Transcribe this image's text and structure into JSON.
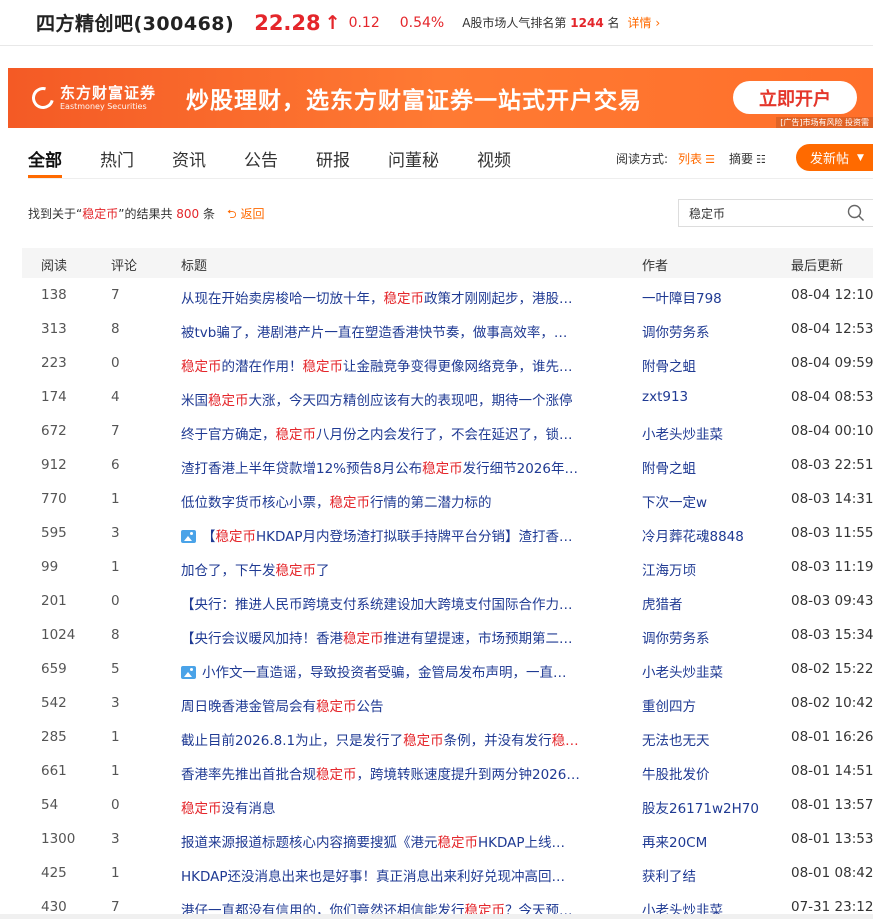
{
  "stock": {
    "name": "四方精创吧(300468)",
    "price": "22.28",
    "change": "0.12",
    "change_pct": "0.54%",
    "rank_prefix": "A股市场人气排名第",
    "rank": "1244",
    "rank_suffix": "名",
    "detail_label": "详情",
    "color_up": "#e4262b"
  },
  "banner": {
    "logo_cn": "东方财富证券",
    "logo_en": "Eastmoney Securities",
    "slogan": "炒股理财，选东方财富证券一站式开户交易",
    "button_label": "立即开户",
    "ad_note": "[广告]市场有风险 投资需",
    "accent": "#f45a25"
  },
  "tabs": [
    {
      "label": "全部",
      "active": true
    },
    {
      "label": "热门",
      "active": false
    },
    {
      "label": "资讯",
      "active": false
    },
    {
      "label": "公告",
      "active": false
    },
    {
      "label": "研报",
      "active": false
    },
    {
      "label": "问董秘",
      "active": false
    },
    {
      "label": "视频",
      "active": false
    }
  ],
  "read_mode": {
    "label": "阅读方式:",
    "list": "列表",
    "summary": "摘要"
  },
  "post_button": "发新帖",
  "search": {
    "result_prefix": "找到关于“",
    "keyword": "稳定币",
    "result_mid": "”的结果共",
    "result_count": "800",
    "result_suffix": "条",
    "back_label": "返回",
    "input_value": "稳定币"
  },
  "table": {
    "headers": {
      "read": "阅读",
      "comment": "评论",
      "title": "标题",
      "author": "作者",
      "updated": "最后更新"
    },
    "rows": [
      {
        "read": "138",
        "comment": "7",
        "image": false,
        "title": [
          "从现在开始卖房梭哈一切放十年，",
          "稳定币",
          "政策才刚刚起步，港股…"
        ],
        "author": "一叶障目798",
        "time": "08-04 12:10"
      },
      {
        "read": "313",
        "comment": "8",
        "image": false,
        "title": [
          "被tvb骗了，港剧港产片一直在塑造香港快节奏，做事高效率，…",
          "",
          ""
        ],
        "author": "调你劳务系",
        "time": "08-04 12:53"
      },
      {
        "read": "223",
        "comment": "0",
        "image": false,
        "title": [
          "",
          "稳定币",
          "的潜在作用！",
          "稳定币",
          "让金融竞争变得更像网络竞争，谁先…"
        ],
        "author": "附骨之蛆",
        "time": "08-04 09:59"
      },
      {
        "read": "174",
        "comment": "4",
        "image": false,
        "title": [
          "米国",
          "稳定币",
          "大涨，今天四方精创应该有大的表现吧，期待一个涨停"
        ],
        "author": "zxt913",
        "time": "08-04 08:53"
      },
      {
        "read": "672",
        "comment": "7",
        "image": false,
        "title": [
          "终于官方确定，",
          "稳定币",
          "八月份之内会发行了，不会在延迟了，锁…"
        ],
        "author": "小老头炒韭菜",
        "time": "08-04 00:10"
      },
      {
        "read": "912",
        "comment": "6",
        "image": false,
        "title": [
          "渣打香港上半年贷款增12%预告8月公布",
          "稳定币",
          "发行细节2026年…"
        ],
        "author": "附骨之蛆",
        "time": "08-03 22:51"
      },
      {
        "read": "770",
        "comment": "1",
        "image": false,
        "title": [
          "低位数字货币核心小票，",
          "稳定币",
          "行情的第二潜力标的"
        ],
        "author": "下次一定w",
        "time": "08-03 14:31"
      },
      {
        "read": "595",
        "comment": "3",
        "image": true,
        "title": [
          "【",
          "稳定币",
          "HKDAP月内登场渣打拟联手持牌平台分销】渣打香…"
        ],
        "author": "冷月葬花魂8848",
        "time": "08-03 11:55"
      },
      {
        "read": "99",
        "comment": "1",
        "image": false,
        "title": [
          "加仓了，下午发",
          "稳定币",
          "了"
        ],
        "author": "江海万顷",
        "time": "08-03 11:19"
      },
      {
        "read": "201",
        "comment": "0",
        "image": false,
        "title": [
          "【央行：推进人民币跨境支付系统建设加大跨境支付国际合作力…",
          "",
          ""
        ],
        "author": "虎猎者",
        "time": "08-03 09:43"
      },
      {
        "read": "1024",
        "comment": "8",
        "image": false,
        "title": [
          "【央行会议暖风加持！香港",
          "稳定币",
          "推进有望提速，市场预期第二…"
        ],
        "author": "调你劳务系",
        "time": "08-03 15:34"
      },
      {
        "read": "659",
        "comment": "5",
        "image": true,
        "title": [
          "小作文一直造谣，导致投资者受骗，金管局发布声明，一直…",
          "",
          ""
        ],
        "author": "小老头炒韭菜",
        "time": "08-02 15:22"
      },
      {
        "read": "542",
        "comment": "3",
        "image": false,
        "title": [
          "周日晚香港金管局会有",
          "稳定币",
          "公告"
        ],
        "author": "重创四方",
        "time": "08-02 10:42"
      },
      {
        "read": "285",
        "comment": "1",
        "image": false,
        "title": [
          "截止目前2026.8.1为止，只是发行了",
          "稳定币",
          "条例，并没有发行",
          "稳…",
          ""
        ],
        "author": "无法也无天",
        "time": "08-01 16:26"
      },
      {
        "read": "661",
        "comment": "1",
        "image": false,
        "title": [
          "香港率先推出首批合规",
          "稳定币",
          "，跨境转账速度提升到两分钟2026…"
        ],
        "author": "牛股批发价",
        "time": "08-01 14:51"
      },
      {
        "read": "54",
        "comment": "0",
        "image": false,
        "title": [
          "",
          "稳定币",
          "没有消息"
        ],
        "author": "股友26171w2H70",
        "time": "08-01 13:57"
      },
      {
        "read": "1300",
        "comment": "3",
        "image": false,
        "title": [
          "报道来源报道标题核心内容摘要搜狐《港元",
          "稳定币",
          "HKDAP上线…"
        ],
        "author": "再来20CM",
        "time": "08-01 13:53"
      },
      {
        "read": "425",
        "comment": "1",
        "image": false,
        "title": [
          "HKDAP还没消息出来也是好事！真正消息出来利好兑现冲高回…",
          "",
          ""
        ],
        "author": "获利了结",
        "time": "08-01 08:42"
      },
      {
        "read": "430",
        "comment": "7",
        "image": false,
        "title": [
          "港仔一直都没有信用的，你们竟然还相信能发行",
          "稳定币",
          "？今天预…"
        ],
        "author": "小老头炒韭菜",
        "time": "07-31 23:12"
      }
    ]
  }
}
